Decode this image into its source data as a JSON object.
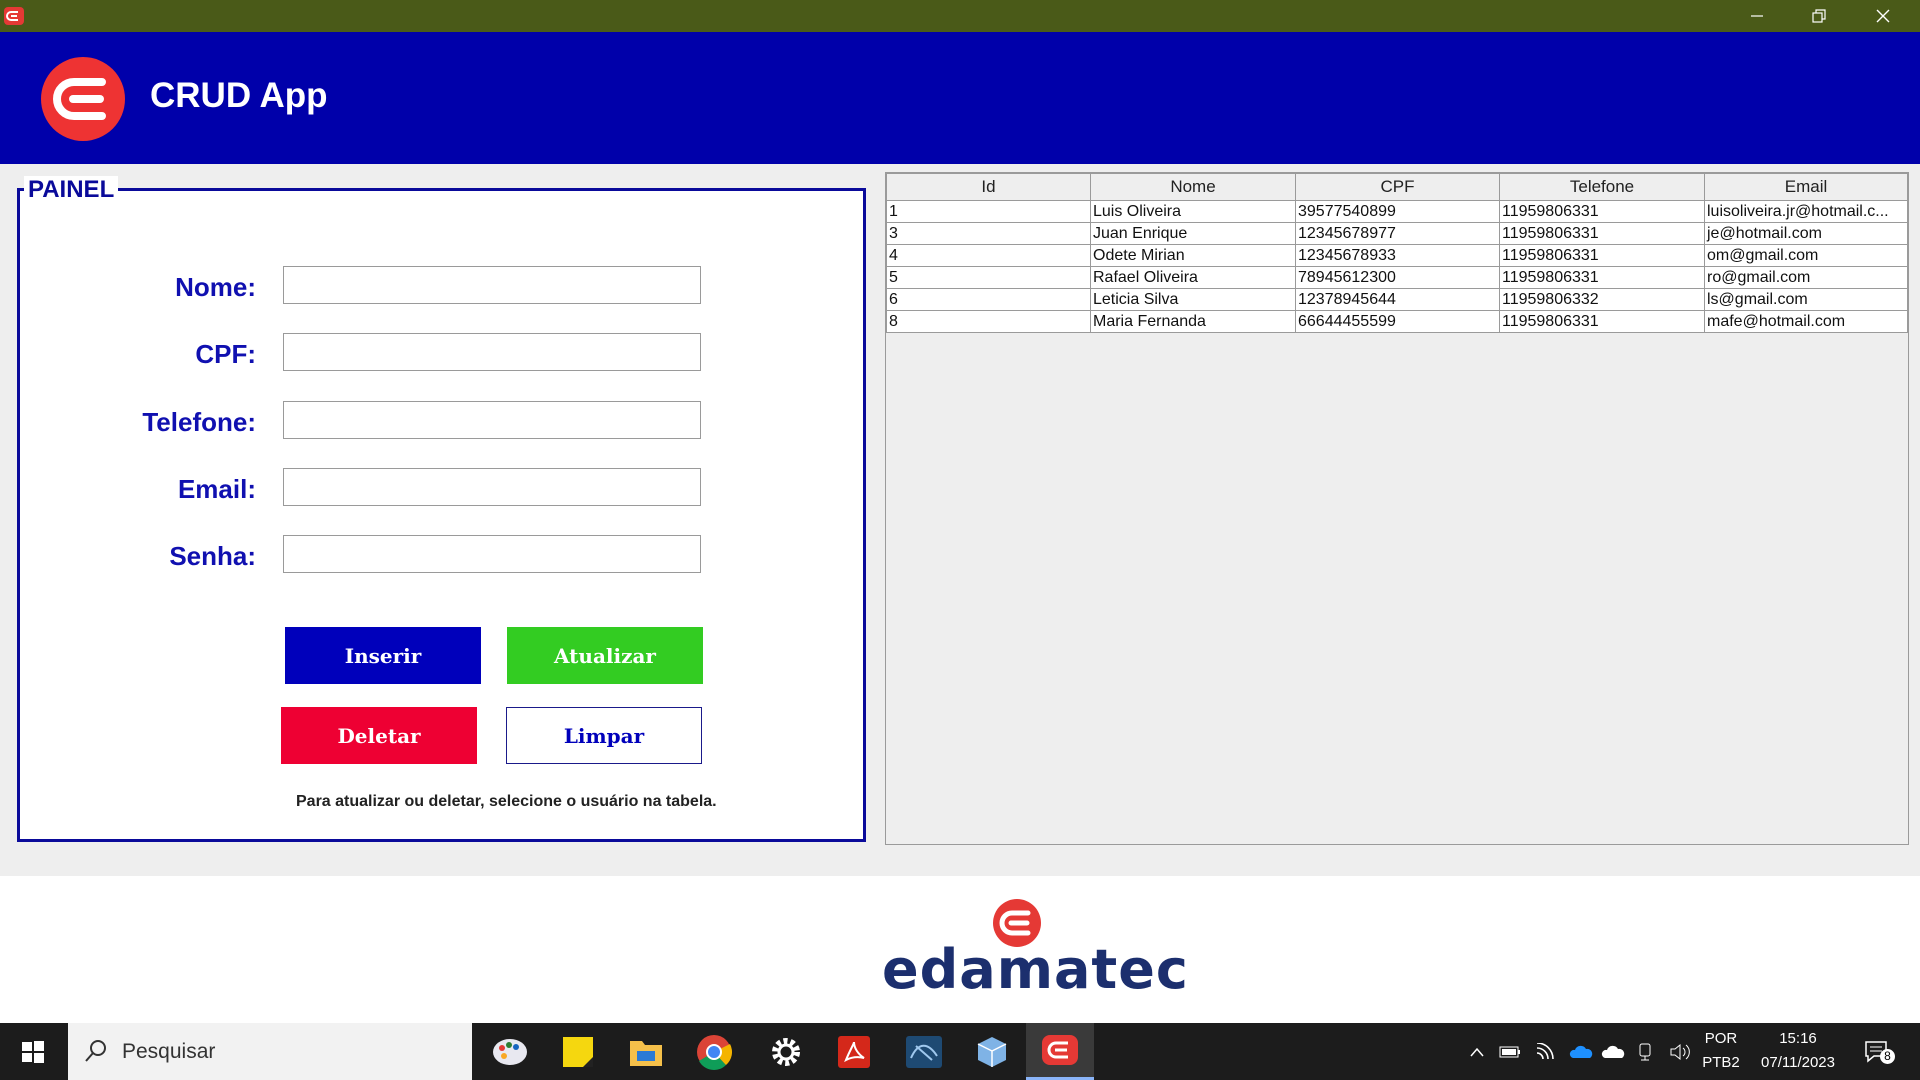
{
  "window": {
    "title_bar_color": "#4a5a18",
    "controls": {
      "minimize": "minimize-icon",
      "restore": "restore-icon",
      "close": "close-icon"
    }
  },
  "header": {
    "title": "CRUD App",
    "background": "#0000aa",
    "logo_icon": "edamatec-logo-icon"
  },
  "panel": {
    "legend": "PAINEL",
    "fields": [
      {
        "label": "Nome:",
        "value": "",
        "placeholder": ""
      },
      {
        "label": "CPF:",
        "value": "",
        "placeholder": ""
      },
      {
        "label": "Telefone:",
        "value": "",
        "placeholder": ""
      },
      {
        "label": "Email:",
        "value": "",
        "placeholder": ""
      },
      {
        "label": "Senha:",
        "value": "",
        "placeholder": ""
      }
    ],
    "buttons": {
      "insert": {
        "label": "Inserir",
        "color": "#0000bb"
      },
      "update": {
        "label": "Atualizar",
        "color": "#33cc22"
      },
      "delete": {
        "label": "Deletar",
        "color": "#ee0033"
      },
      "clear": {
        "label": "Limpar",
        "color": "#ffffff"
      }
    },
    "hint": "Para atualizar ou deletar, selecione o usuário na tabela."
  },
  "table": {
    "columns": [
      "Id",
      "Nome",
      "CPF",
      "Telefone",
      "Email"
    ],
    "rows": [
      [
        "1",
        "Luis Oliveira",
        "39577540899",
        "11959806331",
        "luisoliveira.jr@hotmail.c..."
      ],
      [
        "3",
        "Juan Enrique",
        "12345678977",
        "11959806331",
        "je@hotmail.com"
      ],
      [
        "4",
        "Odete Mirian",
        "12345678933",
        "11959806331",
        "om@gmail.com"
      ],
      [
        "5",
        "Rafael Oliveira",
        "78945612300",
        "11959806331",
        "ro@gmail.com"
      ],
      [
        "6",
        "Leticia Silva",
        "12378945644",
        "11959806332",
        "ls@gmail.com"
      ],
      [
        "8",
        "Maria Fernanda",
        "66644455599",
        "11959806331",
        "mafe@hotmail.com"
      ]
    ]
  },
  "footer": {
    "brand": "edamatec",
    "brand_color": "#1c2f6e"
  },
  "taskbar": {
    "search_placeholder": "Pesquisar",
    "apps": [
      "paint-icon",
      "sticky-notes-icon",
      "file-explorer-icon",
      "chrome-icon",
      "settings-icon",
      "acrobat-icon",
      "mysql-workbench-icon",
      "virtualbox-icon",
      "edamatec-app-icon"
    ],
    "tray": {
      "language_top": "POR",
      "language_bottom": "PTB2",
      "time": "15:16",
      "date": "07/11/2023",
      "notification_count": "8"
    }
  }
}
